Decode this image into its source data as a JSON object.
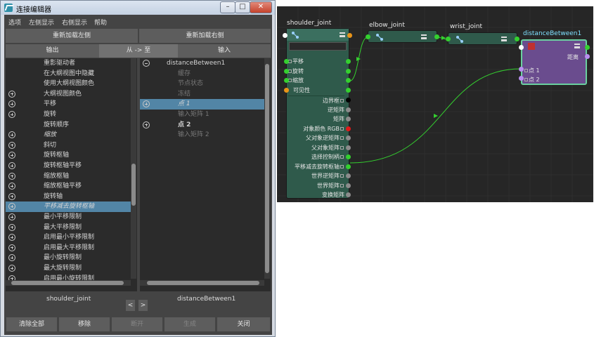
{
  "window": {
    "title": "连接编辑器",
    "min": "–",
    "max": "□",
    "close": "✕"
  },
  "menu": [
    "选项",
    "左侧显示",
    "右侧显示",
    "帮助"
  ],
  "reload": {
    "left": "重新加载左侧",
    "right": "重新加载右侧"
  },
  "tabs": [
    "输出",
    "从 -> 至",
    "输入"
  ],
  "left_list": [
    {
      "label": "重影驱动者",
      "plus": false,
      "style": ""
    },
    {
      "label": "在大纲视图中隐藏",
      "plus": false,
      "style": ""
    },
    {
      "label": "使用大纲视图颜色",
      "plus": false,
      "style": ""
    },
    {
      "label": "大纲视图颜色",
      "plus": true,
      "style": ""
    },
    {
      "label": "平移",
      "plus": true,
      "style": ""
    },
    {
      "label": "旋转",
      "plus": true,
      "style": ""
    },
    {
      "label": "旋转顺序",
      "plus": false,
      "style": ""
    },
    {
      "label": "缩放",
      "plus": true,
      "style": "italic"
    },
    {
      "label": "斜切",
      "plus": true,
      "style": ""
    },
    {
      "label": "旋转枢轴",
      "plus": true,
      "style": ""
    },
    {
      "label": "旋转枢轴平移",
      "plus": true,
      "style": ""
    },
    {
      "label": "缩放枢轴",
      "plus": true,
      "style": ""
    },
    {
      "label": "缩放枢轴平移",
      "plus": true,
      "style": ""
    },
    {
      "label": "旋转轴",
      "plus": true,
      "style": ""
    },
    {
      "label": "平移减去旋转枢轴",
      "plus": true,
      "style": "italic sel"
    },
    {
      "label": "最小平移限制",
      "plus": true,
      "style": ""
    },
    {
      "label": "最大平移限制",
      "plus": true,
      "style": ""
    },
    {
      "label": "启用最小平移限制",
      "plus": true,
      "style": ""
    },
    {
      "label": "启用最大平移限制",
      "plus": true,
      "style": ""
    },
    {
      "label": "最小旋转限制",
      "plus": true,
      "style": ""
    },
    {
      "label": "最大旋转限制",
      "plus": true,
      "style": ""
    },
    {
      "label": "启用最小旋转限制",
      "plus": true,
      "style": ""
    }
  ],
  "right_list": [
    {
      "label": "distanceBetween1",
      "icon": "minus",
      "indent": 0,
      "style": ""
    },
    {
      "label": "缓存",
      "icon": "",
      "indent": 1,
      "style": "dim"
    },
    {
      "label": "节点状态",
      "icon": "",
      "indent": 1,
      "style": "dim"
    },
    {
      "label": "冻结",
      "icon": "",
      "indent": 1,
      "style": "dim"
    },
    {
      "label": "点 1",
      "icon": "plus",
      "indent": 1,
      "style": "italic sel"
    },
    {
      "label": "输入矩阵 1",
      "icon": "",
      "indent": 1,
      "style": "dim"
    },
    {
      "label": "点 2",
      "icon": "plus",
      "indent": 1,
      "style": "bold"
    },
    {
      "label": "输入矩阵 2",
      "icon": "",
      "indent": 1,
      "style": "dim"
    }
  ],
  "footer": {
    "left_node": "shoulder_joint",
    "right_node": "distanceBetween1",
    "prev": "<",
    "next": ">",
    "buttons": [
      {
        "label": "清除全部",
        "enabled": true
      },
      {
        "label": "移除",
        "enabled": true
      },
      {
        "label": "断开",
        "enabled": false
      },
      {
        "label": "生成",
        "enabled": false
      },
      {
        "label": "关闭",
        "enabled": true
      }
    ]
  },
  "graph": {
    "nodes": {
      "shoulder": {
        "title": "shoulder_joint",
        "inputs": [
          {
            "label": "平移",
            "box": true
          },
          {
            "label": "旋转",
            "box": true
          },
          {
            "label": "缩放",
            "box": true
          },
          {
            "label": "可见性",
            "box": false
          }
        ],
        "outputs": [
          {
            "label": "边界框",
            "box": true,
            "port": "black"
          },
          {
            "label": "逆矩阵",
            "box": false,
            "port": "gray"
          },
          {
            "label": "矩阵",
            "box": false,
            "port": "gray"
          },
          {
            "label": "对象颜色 RGB",
            "box": true,
            "port": "red"
          },
          {
            "label": "父对象逆矩阵",
            "box": true,
            "port": "gray"
          },
          {
            "label": "父对象矩阵",
            "box": true,
            "port": "gray"
          },
          {
            "label": "选择控制柄",
            "box": true,
            "port": "green"
          },
          {
            "label": "平移减去旋转枢轴",
            "box": true,
            "port": "green"
          },
          {
            "label": "世界逆矩阵",
            "box": true,
            "port": "gray"
          },
          {
            "label": "世界矩阵",
            "box": true,
            "port": "gray"
          },
          {
            "label": "变换矩阵",
            "box": false,
            "port": "gray"
          }
        ]
      },
      "elbow": {
        "title": "elbow_joint"
      },
      "wrist": {
        "title": "wrist_joint"
      },
      "distance": {
        "title": "distanceBetween1",
        "output": "距离",
        "inputs": [
          "点 1",
          "点 2"
        ]
      }
    },
    "colors": {
      "background": "#262626",
      "node": "#2f5a4b",
      "selected_node": "#6a4c8e",
      "wire": "#34d02f"
    }
  }
}
